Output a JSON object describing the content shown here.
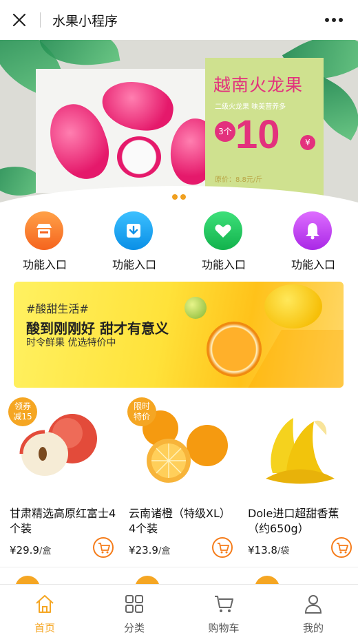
{
  "header": {
    "title": "水果小程序",
    "close_icon": "close-icon",
    "more_icon": "more-icon"
  },
  "banner": {
    "headline": "越南火龙果",
    "subtitle": "二级火龙果 味美营养多",
    "quantity": "3个",
    "price": "10",
    "currency": "¥",
    "original_price": "原价：8.8元/斤",
    "slide_count": 2,
    "active_slide": 1
  },
  "functions": [
    {
      "label": "功能入口",
      "icon": "store-icon",
      "color": "#f7742a"
    },
    {
      "label": "功能入口",
      "icon": "download-icon",
      "color": "#1aa3f0"
    },
    {
      "label": "功能入口",
      "icon": "heart-icon",
      "color": "#20c460"
    },
    {
      "label": "功能入口",
      "icon": "bell-icon",
      "color": "#c04ef0"
    }
  ],
  "promo": {
    "tag": "#酸甜生活#",
    "title": "酸到刚刚好 甜才有意义",
    "subtitle": "时令鲜果 优选特价中"
  },
  "products": [
    {
      "badge": [
        "领券",
        "减15"
      ],
      "name": "甘肃精选高原红富士4个装",
      "currency": "¥",
      "price": "29.9",
      "unit": "/盒"
    },
    {
      "badge": [
        "限时",
        "特价"
      ],
      "name": "云南诸橙（特级XL）4个装",
      "currency": "¥",
      "price": "23.9",
      "unit": "/盒"
    },
    {
      "badge": null,
      "name": "Dole进口超甜香蕉（约650g）",
      "currency": "¥",
      "price": "13.8",
      "unit": "/袋"
    }
  ],
  "tabs": [
    {
      "label": "首页",
      "icon": "home-icon",
      "active": true
    },
    {
      "label": "分类",
      "icon": "grid-icon",
      "active": false
    },
    {
      "label": "购物车",
      "icon": "cart-icon",
      "active": false
    },
    {
      "label": "我的",
      "icon": "user-icon",
      "active": false
    }
  ],
  "colors": {
    "accent": "#f5a623",
    "cart_accent": "#f57c1a",
    "banner_pink": "#e3317d"
  }
}
